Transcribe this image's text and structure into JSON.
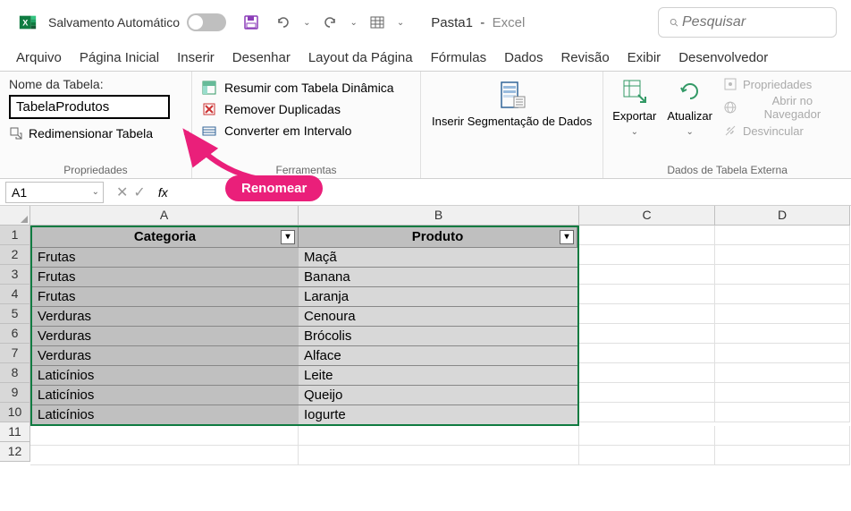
{
  "titlebar": {
    "autosave_label": "Salvamento Automático",
    "document": "Pasta1",
    "app": "Excel",
    "search_placeholder": "Pesquisar"
  },
  "tabs": [
    "Arquivo",
    "Página Inicial",
    "Inserir",
    "Desenhar",
    "Layout da Página",
    "Fórmulas",
    "Dados",
    "Revisão",
    "Exibir",
    "Desenvolvedor"
  ],
  "ribbon": {
    "properties": {
      "label": "Nome da Tabela:",
      "table_name": "TabelaProdutos",
      "resize": "Redimensionar Tabela",
      "group_label": "Propriedades"
    },
    "tools": {
      "pivot": "Resumir com Tabela Dinâmica",
      "dedupe": "Remover Duplicadas",
      "convert": "Converter em Intervalo",
      "group_label": "Ferramentas"
    },
    "slicer": "Inserir Segmentação de Dados",
    "export": "Exportar",
    "refresh": "Atualizar",
    "external": {
      "props": "Propriedades",
      "browser": "Abrir no Navegador",
      "unlink": "Desvincular",
      "group_label": "Dados de Tabela Externa"
    }
  },
  "namebox": "A1",
  "table": {
    "headers": [
      "Categoria",
      "Produto"
    ],
    "rows": [
      [
        "Frutas",
        "Maçã"
      ],
      [
        "Frutas",
        "Banana"
      ],
      [
        "Frutas",
        "Laranja"
      ],
      [
        "Verduras",
        "Cenoura"
      ],
      [
        "Verduras",
        "Brócolis"
      ],
      [
        "Verduras",
        "Alface"
      ],
      [
        "Laticínios",
        "Leite"
      ],
      [
        "Laticínios",
        "Queijo"
      ],
      [
        "Laticínios",
        "Iogurte"
      ]
    ]
  },
  "columns": [
    "A",
    "B",
    "C",
    "D"
  ],
  "row_numbers": [
    "1",
    "2",
    "3",
    "4",
    "5",
    "6",
    "7",
    "8",
    "9",
    "10",
    "11",
    "12"
  ],
  "annotation": "Renomear"
}
